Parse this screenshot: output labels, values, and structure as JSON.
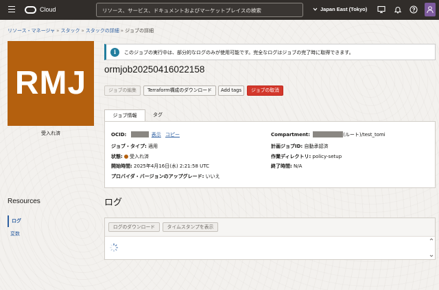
{
  "topbar": {
    "brand": "Cloud",
    "search_placeholder": "リソース、サービス、ドキュメントおよびマーケットプレイスの検索",
    "region": "Japan East (Tokyo)"
  },
  "breadcrumb": {
    "items": [
      "リソース・マネージャ",
      "スタック",
      "スタックの詳細",
      "ジョブの詳細"
    ],
    "separator": "»"
  },
  "job": {
    "badge": "RMJ",
    "badge_color": "#b4600e",
    "status_label": "受入れ済",
    "title": "ormjob20250416022158",
    "banner": "このジョブの実行中は、部分的なログのみが使用可能です。完全なログはジョブの完了時に取得できます。",
    "actions": {
      "edit": "ジョブの編集",
      "download_tf": "Terraform構成のダウンロード",
      "add_tags": "Add tags",
      "cancel": "ジョブの取消"
    }
  },
  "tabs": [
    "ジョブ情報",
    "タグ"
  ],
  "info": {
    "ocid_label": "OCID:",
    "show_link": "表示",
    "copy_link": "コピー",
    "job_type_label": "ジョブ・タイプ:",
    "job_type_value": "適用",
    "state_label": "状態:",
    "state_value": "受入れ済",
    "start_label": "開始時間:",
    "start_value": "2025年4月16日(水) 2:21:58 UTC",
    "provider_upgrade_label": "プロバイダ・バージョンのアップグレード:",
    "provider_upgrade_value": "いいえ",
    "compartment_label": "Compartment:",
    "compartment_value": "(ルート)/test_tomi",
    "plan_job_label": "計画ジョブID:",
    "plan_job_value": "自動承認済",
    "workdir_label": "作業ディレクトリ:",
    "workdir_value": "policy-setup",
    "end_label": "終了時間:",
    "end_value": "N/A"
  },
  "resources": {
    "title": "Resources",
    "items": [
      "ログ",
      "変数"
    ]
  },
  "logs": {
    "title": "ログ",
    "download_button": "ログのダウンロード",
    "timestamp_button": "タイムスタンプを表示"
  },
  "colors": {
    "topbar": "#312d2a",
    "accent_link": "#2d5fa1",
    "danger": "#d3382c",
    "info": "#227e9e"
  }
}
